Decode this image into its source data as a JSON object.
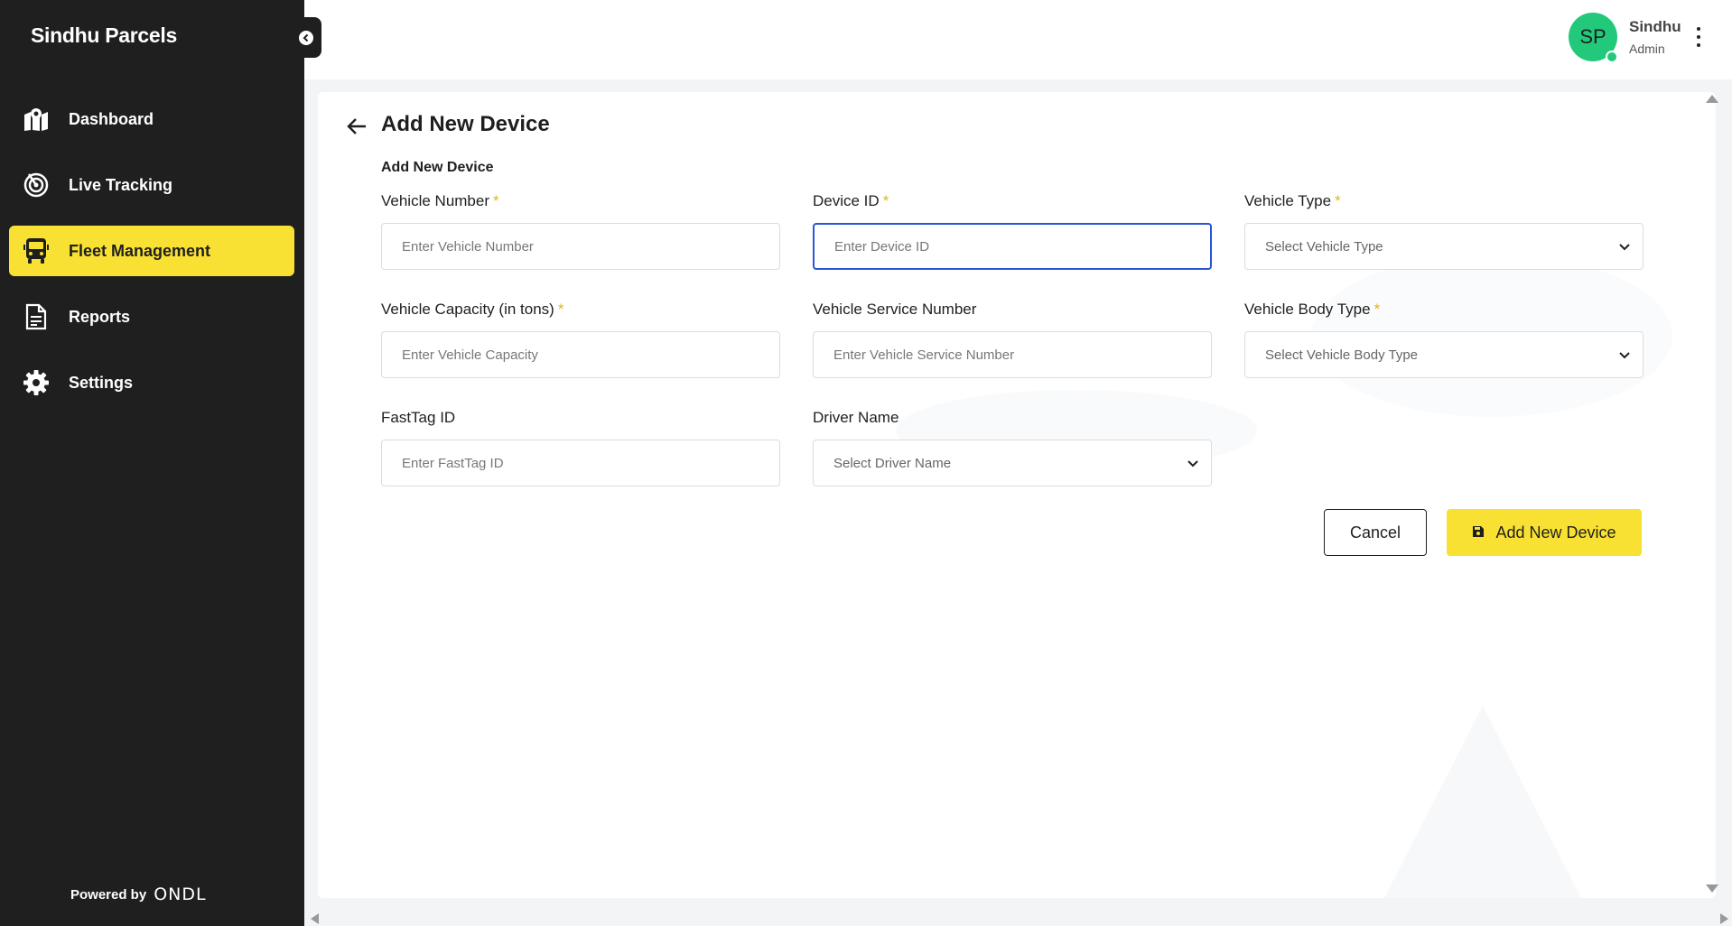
{
  "sidebar": {
    "brand": "Sindhu Parcels",
    "items": [
      {
        "label": "Dashboard",
        "icon": "map-pin-icon"
      },
      {
        "label": "Live Tracking",
        "icon": "radar-icon"
      },
      {
        "label": "Fleet Management",
        "icon": "bus-icon",
        "active": true
      },
      {
        "label": "Reports",
        "icon": "document-icon"
      },
      {
        "label": "Settings",
        "icon": "gear-icon"
      }
    ],
    "powered_by": "Powered by",
    "powered_logo": "ONDL"
  },
  "header": {
    "avatar_initials": "SP",
    "user_name": "Sindhu",
    "user_role": "Admin"
  },
  "page": {
    "title": "Add New Device",
    "section_title": "Add New Device"
  },
  "form": {
    "vehicle_number": {
      "label": "Vehicle Number",
      "required": "*",
      "placeholder": "Enter Vehicle Number",
      "value": ""
    },
    "device_id": {
      "label": "Device ID",
      "required": "*",
      "placeholder": "Enter Device ID",
      "value": ""
    },
    "vehicle_type": {
      "label": "Vehicle Type",
      "required": "*",
      "selected": "Select Vehicle Type"
    },
    "vehicle_capacity": {
      "label": "Vehicle Capacity (in tons)",
      "required": "*",
      "placeholder": "Enter Vehicle Capacity",
      "value": ""
    },
    "vehicle_service_number": {
      "label": "Vehicle Service Number",
      "placeholder": "Enter Vehicle Service Number",
      "value": ""
    },
    "vehicle_body_type": {
      "label": "Vehicle Body Type",
      "required": "*",
      "selected": "Select Vehicle Body Type"
    },
    "fasttag_id": {
      "label": "FastTag ID",
      "placeholder": "Enter FastTag ID",
      "value": ""
    },
    "driver_name": {
      "label": "Driver Name",
      "selected": "Select Driver Name"
    }
  },
  "actions": {
    "cancel_label": "Cancel",
    "submit_label": "Add New Device"
  },
  "colors": {
    "sidebar_bg": "#1f1f1f",
    "accent_yellow": "#f8e132",
    "avatar_green": "#22c97a",
    "focus_blue": "#2a56d6",
    "required_star": "#e2b514"
  }
}
